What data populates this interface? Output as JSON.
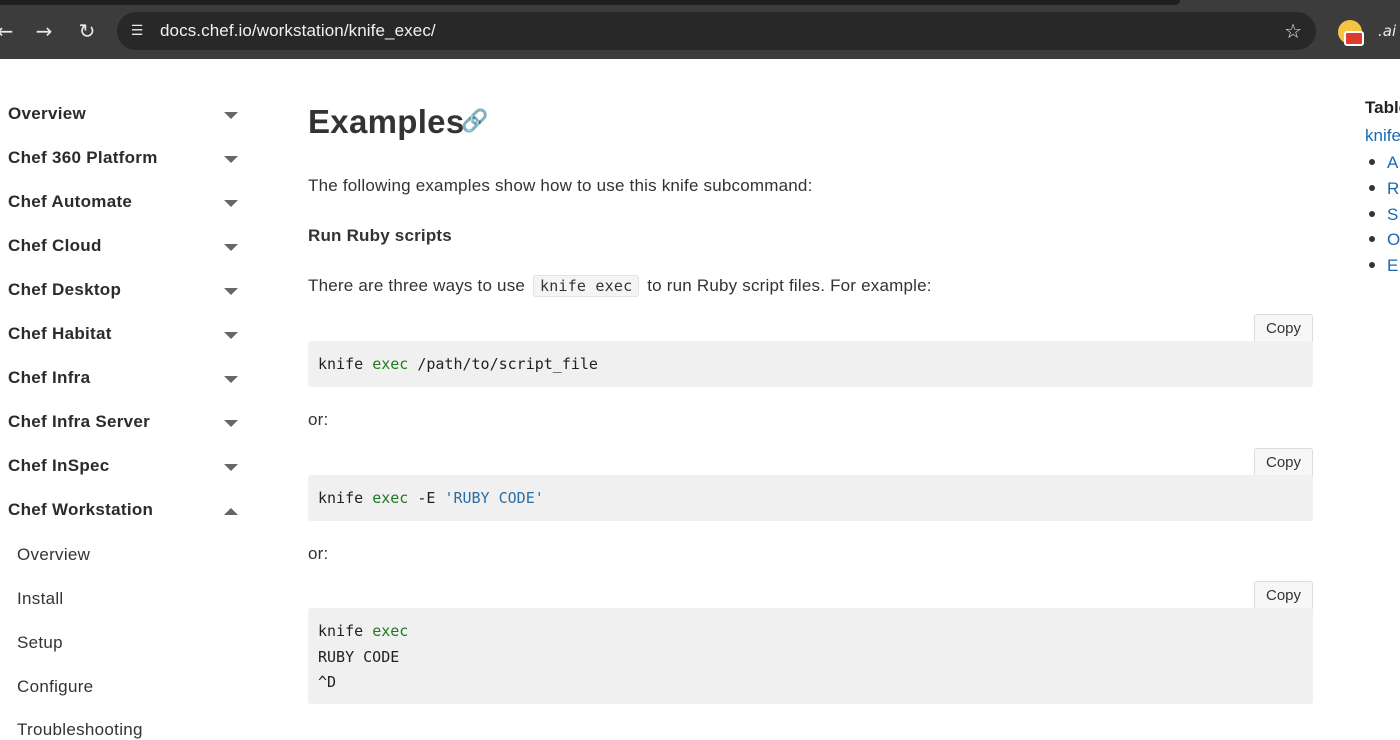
{
  "browser": {
    "url": "docs.chef.io/workstation/knife_exec/",
    "back_icon": "arrow-left-icon",
    "forward_icon": "arrow-right-icon",
    "reload_icon": "reload-icon",
    "site_info_icon": "tune-icon",
    "bookmark_icon": "star-icon"
  },
  "sidebar": {
    "items": [
      {
        "label": "Overview",
        "expanded": false
      },
      {
        "label": "Chef 360 Platform",
        "expanded": false
      },
      {
        "label": "Chef Automate",
        "expanded": false
      },
      {
        "label": "Chef Cloud",
        "expanded": false
      },
      {
        "label": "Chef Desktop",
        "expanded": false
      },
      {
        "label": "Chef Habitat",
        "expanded": false
      },
      {
        "label": "Chef Infra",
        "expanded": false
      },
      {
        "label": "Chef Infra Server",
        "expanded": false
      },
      {
        "label": "Chef InSpec",
        "expanded": false
      },
      {
        "label": "Chef Workstation",
        "expanded": true
      }
    ],
    "sub_items": [
      "Overview",
      "Install",
      "Setup",
      "Configure",
      "Troubleshooting"
    ]
  },
  "main": {
    "title": "Examples",
    "intro": "The following examples show how to use this knife subcommand:",
    "section_heading": "Run Ruby scripts",
    "para_before": "There are three ways to use",
    "inline_code": "knife exec",
    "para_after": "to run Ruby script files. For example:",
    "or_1": "or:",
    "or_2": "or:",
    "copy_label": "Copy",
    "code1": {
      "cmd": "knife",
      "kw": "exec",
      "rest": " /path/to/script_file"
    },
    "code2": {
      "cmd": "knife",
      "kw": "exec",
      "flag": " -E ",
      "str": "'RUBY CODE'"
    },
    "code3": {
      "line1_cmd": "knife",
      "line1_kw": "exec",
      "line2": "RUBY CODE",
      "line3": "^D"
    }
  },
  "toc": {
    "title": "Table of Contents",
    "link": "knife exec",
    "items": [
      "A",
      "R",
      "S",
      "O",
      "E"
    ]
  }
}
